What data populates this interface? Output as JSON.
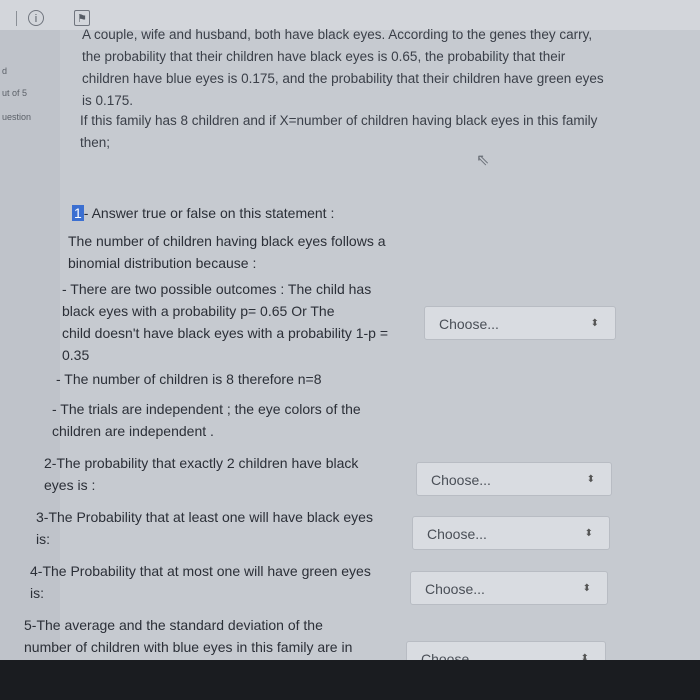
{
  "header": {
    "info_icon": "i",
    "flag_icon": "flag"
  },
  "sidebar": {
    "label1": "d",
    "label2": "ut of 5",
    "label3": "uestion"
  },
  "question": {
    "stem_lines": [
      "A couple, wife and husband, both have black eyes. According to the genes they carry,",
      "the probability that their children have black eyes is 0.65, the probability that their",
      "children have blue eyes is 0.175, and the probability that their children have green eyes",
      "is 0.175."
    ],
    "condition_lines": [
      "If this family has 8 children and if X=number of children having black eyes in this family",
      "then;"
    ]
  },
  "items": {
    "q1": {
      "number": "1",
      "title": "- Answer true or false on this statement :",
      "lines": [
        "The number of children having black eyes follows a",
        "binomial distribution because :",
        "- There are two possible outcomes : The child has",
        "black eyes with a probability p= 0.65 Or The",
        "child doesn't have black eyes with a probability 1-p =",
        "0.35",
        "- The number of children is 8 therefore n=8",
        "- The trials are independent ; the eye colors of the",
        "children are independent ."
      ]
    },
    "q2": {
      "line1": "2-The probability that exactly 2 children have black",
      "line2": "eyes is :"
    },
    "q3": {
      "line1": "3-The Probability that at least one will have black eyes",
      "line2": "is:"
    },
    "q4": {
      "line1": "4-The Probability that at most one will have green eyes",
      "line2": "is:"
    },
    "q5": {
      "line1": "5-The average and the standard deviation of the",
      "line2": "number of children with blue eyes in this family are in"
    }
  },
  "select_placeholder": "Choose...",
  "caret": "⬍"
}
